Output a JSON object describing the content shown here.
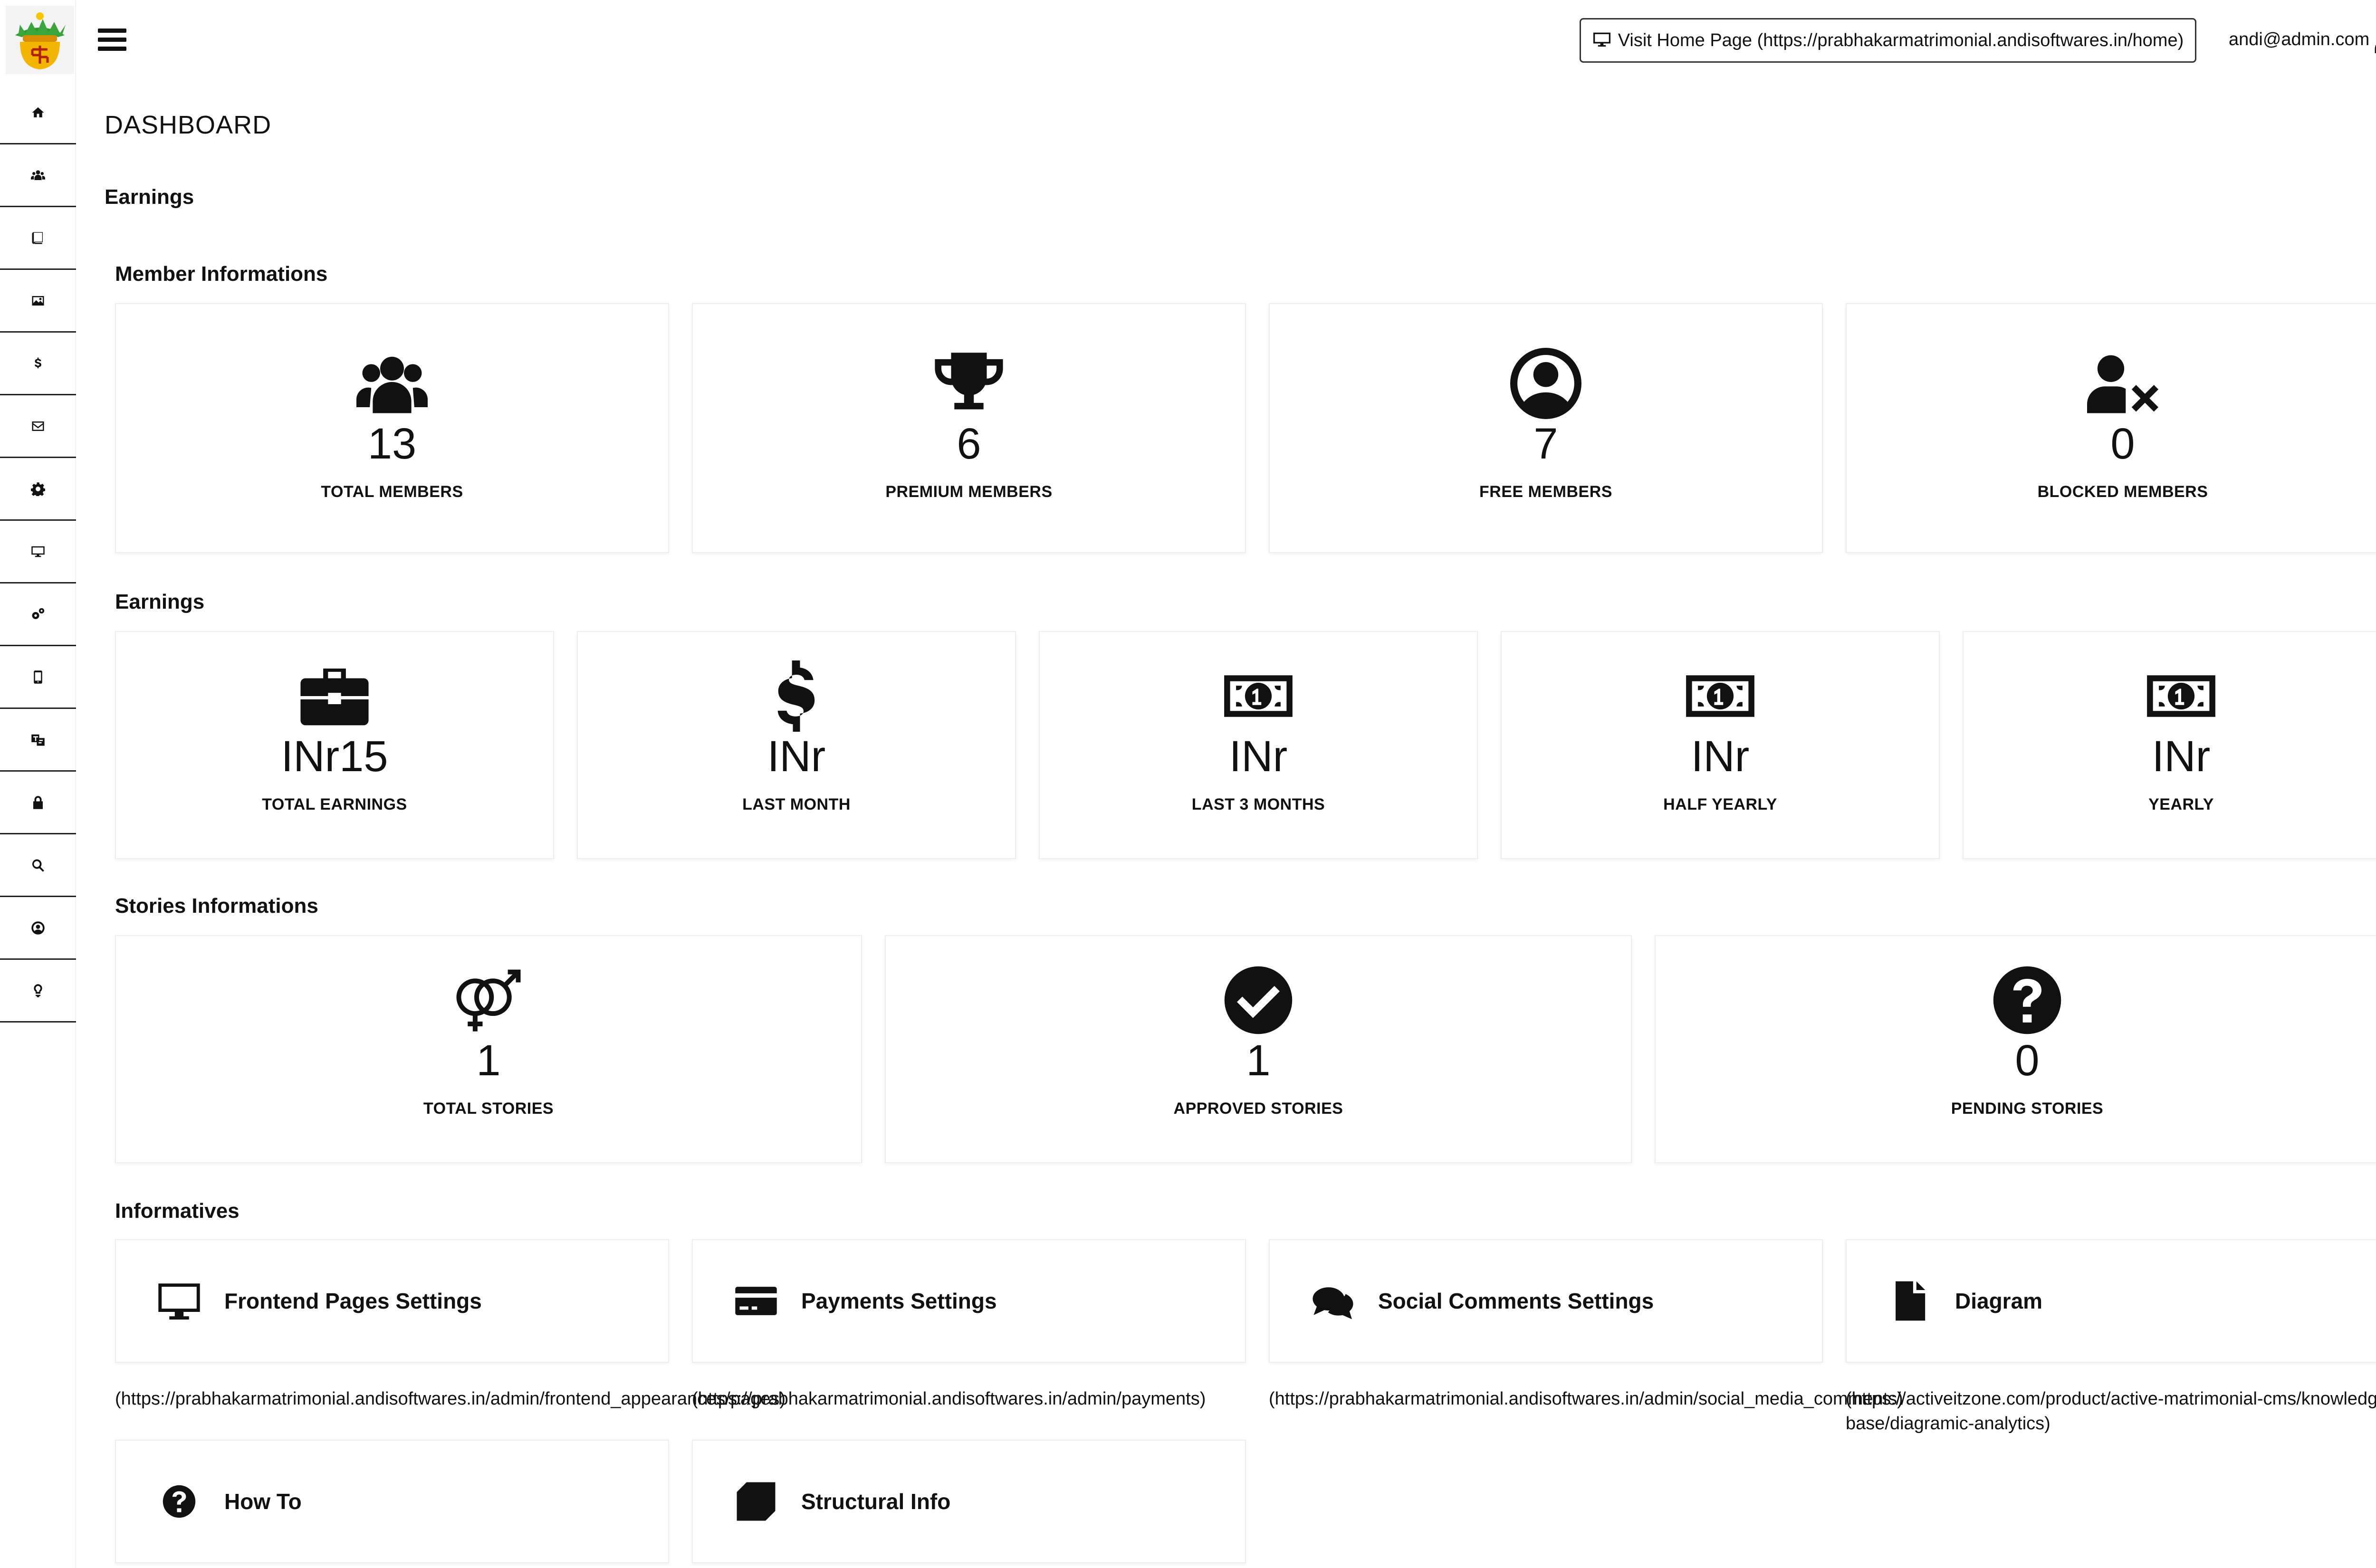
{
  "sidebar": {
    "items": [
      {
        "icon": "home-icon"
      },
      {
        "icon": "users-icon"
      },
      {
        "icon": "book-icon"
      },
      {
        "icon": "image-icon"
      },
      {
        "icon": "dollar-icon"
      },
      {
        "icon": "envelope-icon"
      },
      {
        "icon": "gear-icon"
      },
      {
        "icon": "monitor-icon"
      },
      {
        "icon": "cogs-icon"
      },
      {
        "icon": "mobile-icon"
      },
      {
        "icon": "language-icon"
      },
      {
        "icon": "lock-icon"
      },
      {
        "icon": "search-icon"
      },
      {
        "icon": "user-circle-icon"
      },
      {
        "icon": "lightbulb-icon"
      }
    ]
  },
  "header": {
    "visit_label": "Visit Home Page (https://prabhakarmatrimonial.andisoftwares.in/home)",
    "user_email": "andi@admin.com"
  },
  "main": {
    "title": "DASHBOARD",
    "earnings_heading": "Earnings"
  },
  "members": {
    "title": "Member Informations",
    "cards": [
      {
        "value": "13",
        "label": "TOTAL MEMBERS",
        "icon": "users-icon"
      },
      {
        "value": "6",
        "label": "PREMIUM MEMBERS",
        "icon": "trophy-icon"
      },
      {
        "value": "7",
        "label": "FREE MEMBERS",
        "icon": "user-circle-icon"
      },
      {
        "value": "0",
        "label": "BLOCKED MEMBERS",
        "icon": "user-blocked-icon"
      }
    ]
  },
  "earnings": {
    "title": "Earnings",
    "cards": [
      {
        "value": "INr15",
        "label": "TOTAL EARNINGS",
        "icon": "briefcase-icon"
      },
      {
        "value": "INr",
        "label": "LAST MONTH",
        "icon": "dollar-icon"
      },
      {
        "value": "INr",
        "label": "LAST 3 MONTHS",
        "icon": "money-bill-icon"
      },
      {
        "value": "INr",
        "label": "HALF YEARLY",
        "icon": "money-bill-icon"
      },
      {
        "value": "INr",
        "label": "YEARLY",
        "icon": "money-bill-icon"
      }
    ]
  },
  "stories": {
    "title": "Stories Informations",
    "cards": [
      {
        "value": "1",
        "label": "TOTAL STORIES",
        "icon": "venus-mars-icon"
      },
      {
        "value": "1",
        "label": "APPROVED STORIES",
        "icon": "check-circle-icon"
      },
      {
        "value": "0",
        "label": "PENDING STORIES",
        "icon": "question-circle-icon"
      }
    ]
  },
  "informatives": {
    "title": "Informatives",
    "items": [
      {
        "title": "Frontend Pages Settings",
        "icon": "desktop-icon",
        "url": "(https://prabhakarmatrimonial.andisoftwares.in/admin/frontend_appearances/pages)"
      },
      {
        "title": "Payments Settings",
        "icon": "credit-card-icon",
        "url": "(https://prabhakarmatrimonial.andisoftwares.in/admin/payments)"
      },
      {
        "title": "Social Comments Settings",
        "icon": "comments-icon",
        "url": "(https://prabhakarmatrimonial.andisoftwares.in/admin/social_media_comments)"
      },
      {
        "title": "Diagram",
        "icon": "file-icon",
        "url": "(https://activeitzone.com/product/active-matrimonial-cms/knowledge-base/diagramic-analytics)"
      },
      {
        "title": "How To",
        "icon": "question-circle-icon",
        "url": ""
      },
      {
        "title": "Structural Info",
        "icon": "cube-icon",
        "url": ""
      }
    ]
  }
}
